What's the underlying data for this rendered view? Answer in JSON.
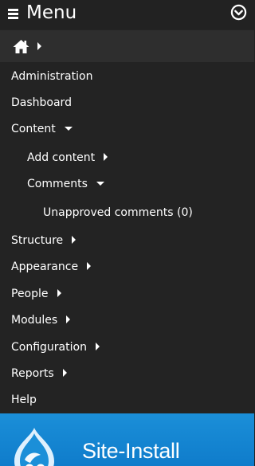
{
  "header": {
    "title": "Menu",
    "menu_icon": "hamburger-icon",
    "toggle_icon": "chevron-down-circle-icon"
  },
  "breadcrumb": {
    "home_icon": "home-icon"
  },
  "menu": {
    "items": [
      {
        "label": "Administration",
        "level": 0,
        "expander": "none"
      },
      {
        "label": "Dashboard",
        "level": 0,
        "expander": "none"
      },
      {
        "label": "Content",
        "level": 0,
        "expander": "expanded"
      },
      {
        "label": "Add content",
        "level": 1,
        "expander": "collapsed"
      },
      {
        "label": "Comments",
        "level": 1,
        "expander": "expanded"
      },
      {
        "label": "Unapproved comments (0)",
        "level": 2,
        "expander": "none"
      },
      {
        "label": "Structure",
        "level": 0,
        "expander": "collapsed"
      },
      {
        "label": "Appearance",
        "level": 0,
        "expander": "collapsed"
      },
      {
        "label": "People",
        "level": 0,
        "expander": "collapsed"
      },
      {
        "label": "Modules",
        "level": 0,
        "expander": "collapsed"
      },
      {
        "label": "Configuration",
        "level": 0,
        "expander": "collapsed"
      },
      {
        "label": "Reports",
        "level": 0,
        "expander": "collapsed"
      },
      {
        "label": "Help",
        "level": 0,
        "expander": "none"
      }
    ]
  },
  "site": {
    "name": "Site-Install",
    "logo_icon": "drupal-drop-icon"
  },
  "colors": {
    "menu_background": "#232323",
    "breadcrumb_background": "#2e2e2e",
    "banner_blue": "#1587d3",
    "text": "#ffffff"
  }
}
